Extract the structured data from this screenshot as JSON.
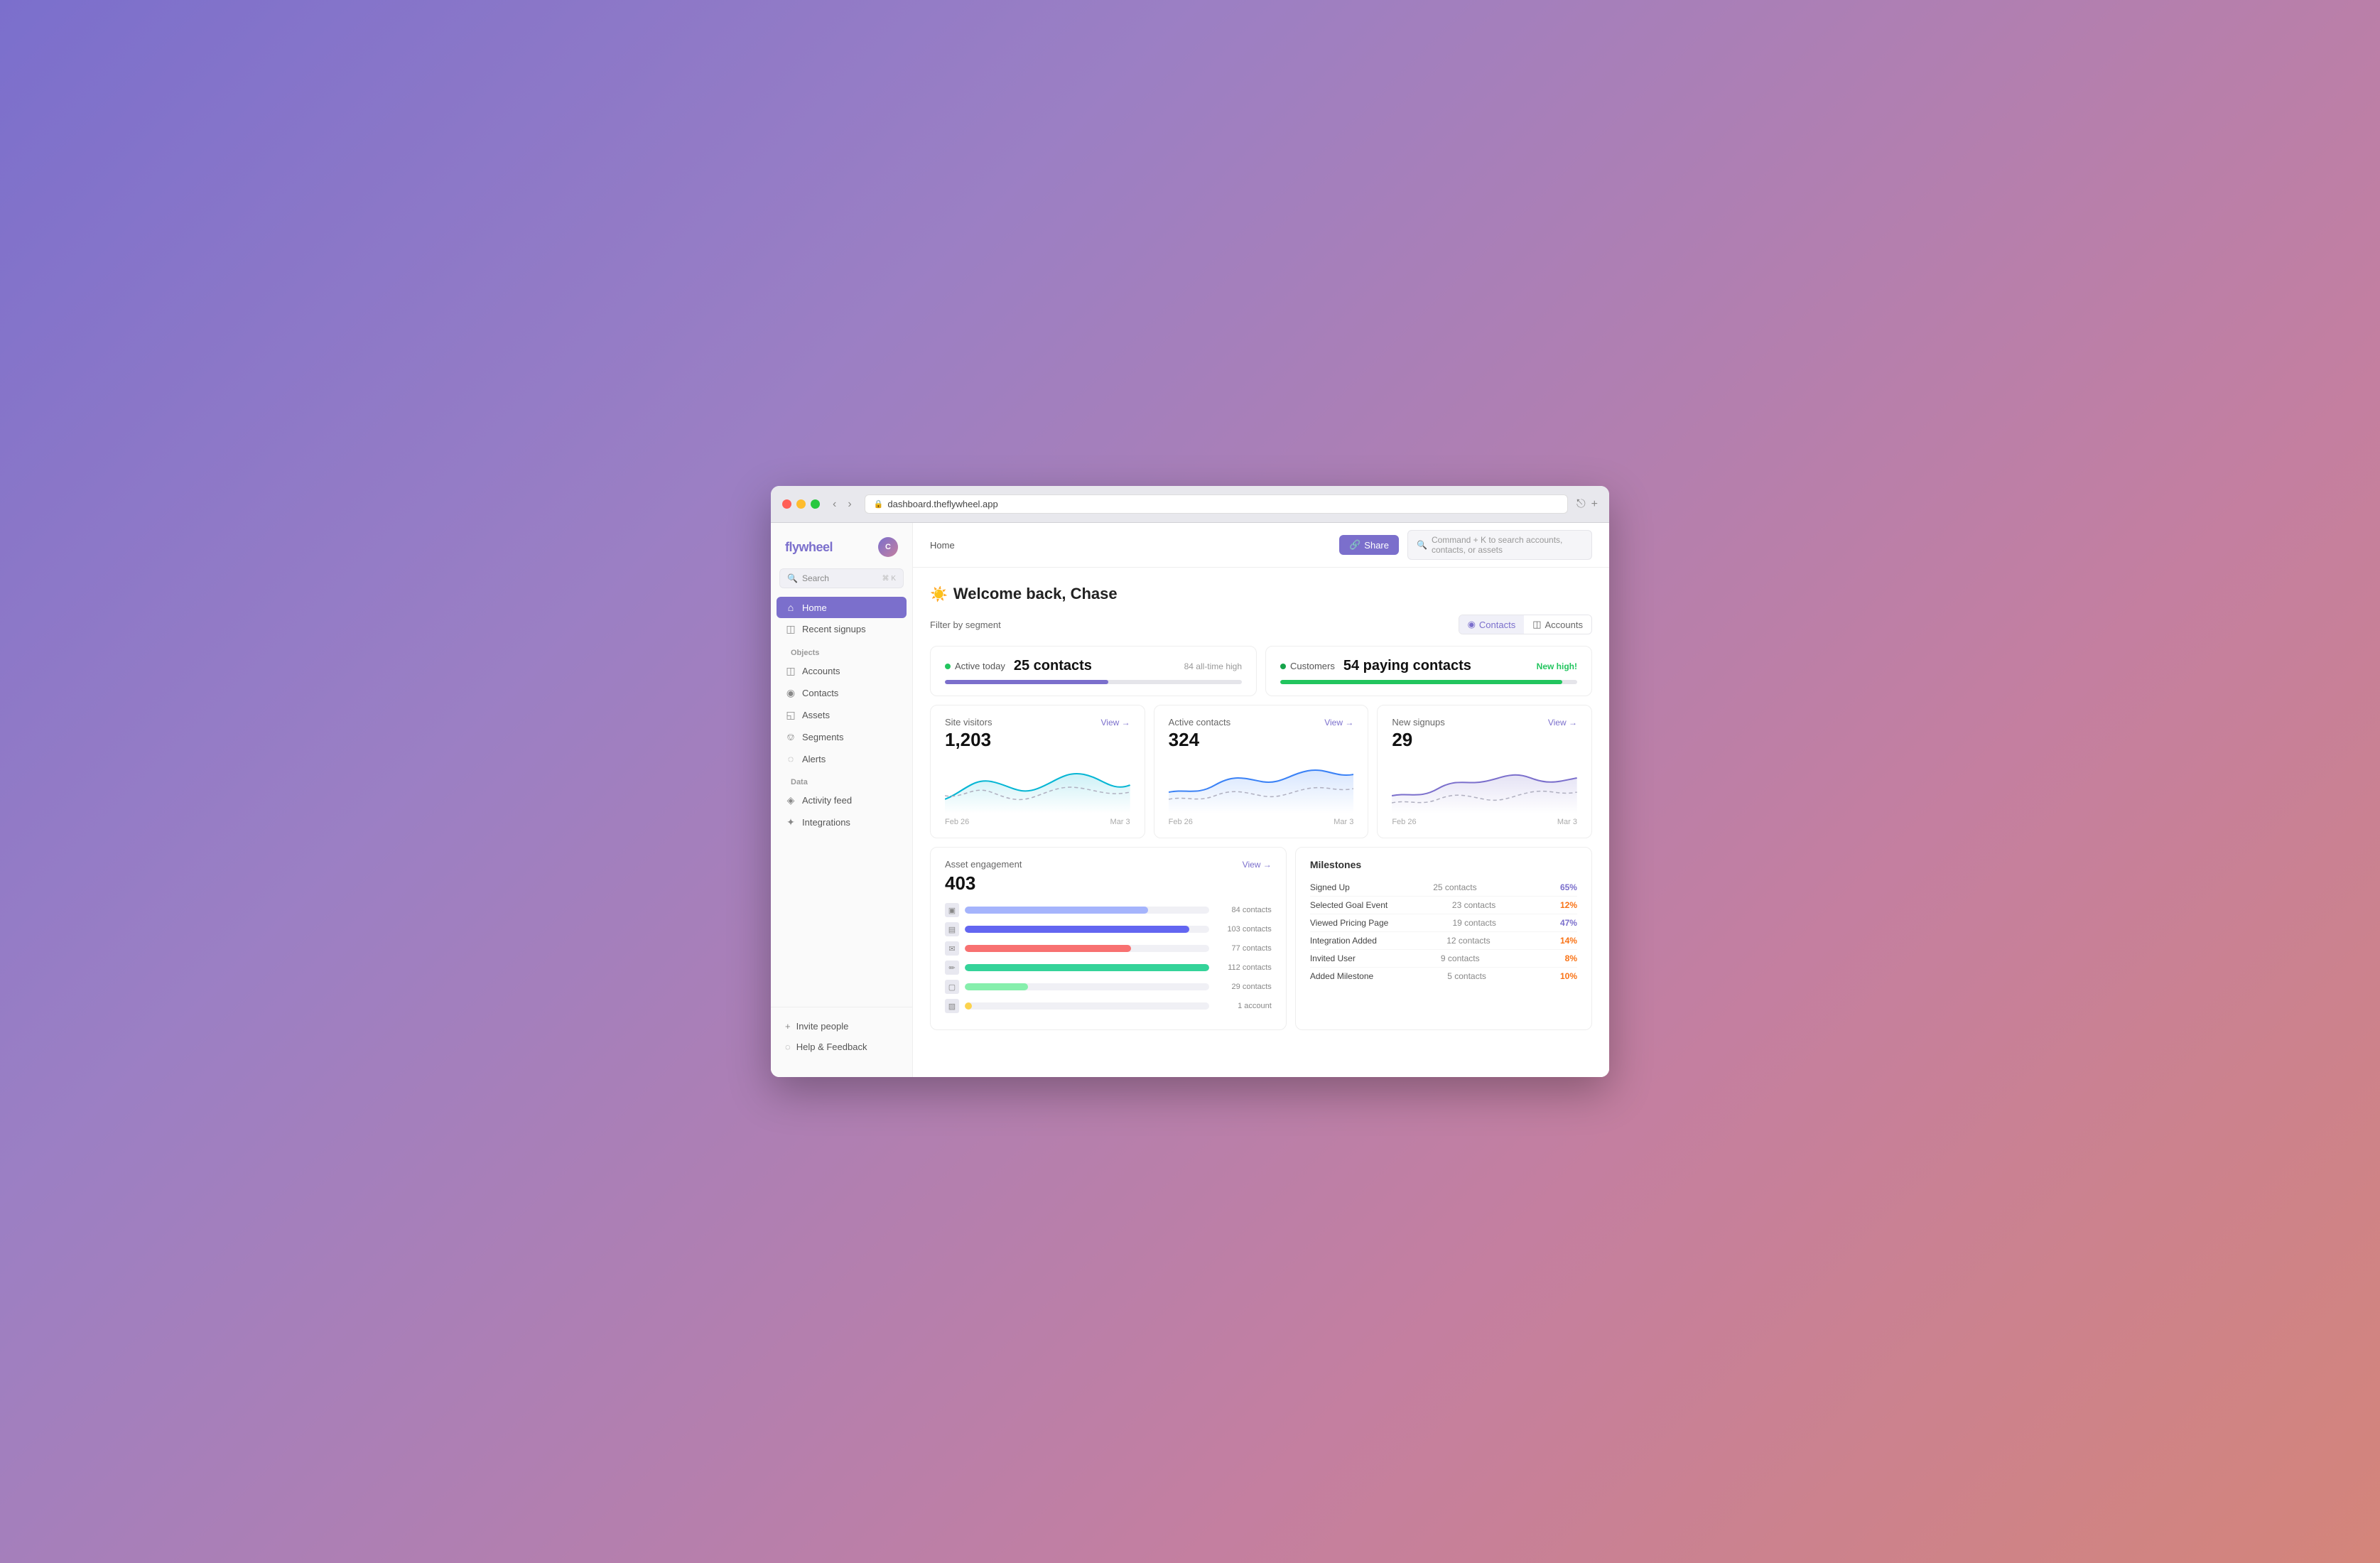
{
  "browser": {
    "url": "dashboard.theflywheel.app",
    "back_btn": "‹",
    "forward_btn": "›",
    "refresh_icon": "↻",
    "share_icon": "⎋",
    "new_tab_icon": "+"
  },
  "sidebar": {
    "logo": "flywheel",
    "search_placeholder": "Search",
    "search_shortcut": "⌘ K",
    "nav_items": [
      {
        "id": "home",
        "label": "Home",
        "icon": "⌂",
        "active": true
      },
      {
        "id": "recent-signups",
        "label": "Recent signups",
        "icon": "◫"
      }
    ],
    "objects_label": "Objects",
    "object_items": [
      {
        "id": "accounts",
        "label": "Accounts",
        "icon": "◫"
      },
      {
        "id": "contacts",
        "label": "Contacts",
        "icon": "◉"
      },
      {
        "id": "assets",
        "label": "Assets",
        "icon": "◱"
      },
      {
        "id": "segments",
        "label": "Segments",
        "icon": "⎊"
      },
      {
        "id": "alerts",
        "label": "Alerts",
        "icon": "◌"
      }
    ],
    "data_label": "Data",
    "data_items": [
      {
        "id": "activity-feed",
        "label": "Activity feed",
        "icon": "◈"
      },
      {
        "id": "integrations",
        "label": "Integrations",
        "icon": "✦"
      }
    ],
    "bottom_items": [
      {
        "id": "invite",
        "label": "Invite people",
        "icon": "+"
      },
      {
        "id": "help",
        "label": "Help & Feedback",
        "icon": "◌"
      }
    ]
  },
  "topbar": {
    "breadcrumb": "Home",
    "share_label": "Share",
    "share_icon": "🔗",
    "search_placeholder": "Command + K to search accounts, contacts, or assets"
  },
  "page": {
    "welcome_icon": "☀️",
    "welcome_title": "Welcome back, Chase",
    "filter_label": "Filter by segment",
    "segment_buttons": [
      {
        "id": "contacts",
        "label": "Contacts",
        "icon": "◉",
        "active": true
      },
      {
        "id": "accounts",
        "label": "Accounts",
        "icon": "◫",
        "active": false
      }
    ]
  },
  "stat_cards": [
    {
      "id": "active-today",
      "dot_color": "green",
      "label": "Active today",
      "value": "25 contacts",
      "high_text": "84 all-time high",
      "progress_pct": 55,
      "bar_color": "#7b6fcc"
    },
    {
      "id": "customers",
      "dot_color": "dark-green",
      "label": "Customers",
      "value": "54 paying contacts",
      "high_text": "New high!",
      "high_color": "green",
      "progress_pct": 95,
      "bar_color": "#22c55e"
    }
  ],
  "charts": [
    {
      "id": "site-visitors",
      "label": "Site visitors",
      "value": "1,203",
      "view_label": "View →",
      "date_start": "Feb 26",
      "date_end": "Mar 3",
      "color": "#06b6d4",
      "dashed_color": "#b0b0c0"
    },
    {
      "id": "active-contacts",
      "label": "Active contacts",
      "value": "324",
      "view_label": "View →",
      "date_start": "Feb 26",
      "date_end": "Mar 3",
      "color": "#3b82f6",
      "dashed_color": "#b0b0c0"
    },
    {
      "id": "new-signups",
      "label": "New signups",
      "value": "29",
      "view_label": "View →",
      "date_start": "Feb 26",
      "date_end": "Mar 3",
      "color": "#7b6fcc",
      "dashed_color": "#b0b0c0"
    }
  ],
  "asset_engagement": {
    "label": "Asset engagement",
    "value": "403",
    "view_label": "View →",
    "bars": [
      {
        "id": "bar1",
        "icon": "▣",
        "color": "#a5b4fc",
        "pct": 75,
        "count": "84 contacts"
      },
      {
        "id": "bar2",
        "icon": "▤",
        "color": "#6366f1",
        "pct": 92,
        "count": "103 contacts"
      },
      {
        "id": "bar3",
        "icon": "✉",
        "color": "#f87171",
        "pct": 68,
        "count": "77 contacts"
      },
      {
        "id": "bar4",
        "icon": "✏",
        "color": "#34d399",
        "pct": 100,
        "count": "112 contacts"
      },
      {
        "id": "bar5",
        "icon": "▢",
        "color": "#86efac",
        "pct": 26,
        "count": "29 contacts"
      },
      {
        "id": "bar6",
        "icon": "▨",
        "color": "#fcd34d",
        "pct": 1,
        "count": "1 account"
      }
    ]
  },
  "milestones": {
    "title": "Milestones",
    "items": [
      {
        "id": "signed-up",
        "name": "Signed Up",
        "contacts": "25 contacts",
        "pct": "65%",
        "pct_color": "blue"
      },
      {
        "id": "goal-event",
        "name": "Selected Goal Event",
        "contacts": "23 contacts",
        "pct": "12%",
        "pct_color": "orange"
      },
      {
        "id": "pricing-page",
        "name": "Viewed Pricing Page",
        "contacts": "19 contacts",
        "pct": "47%",
        "pct_color": "blue"
      },
      {
        "id": "integration-added",
        "name": "Integration Added",
        "contacts": "12 contacts",
        "pct": "14%",
        "pct_color": "orange"
      },
      {
        "id": "invited-user",
        "name": "Invited User",
        "contacts": "9 contacts",
        "pct": "8%",
        "pct_color": "orange"
      },
      {
        "id": "added-milestone",
        "name": "Added Milestone",
        "contacts": "5 contacts",
        "pct": "10%",
        "pct_color": "orange"
      }
    ]
  }
}
